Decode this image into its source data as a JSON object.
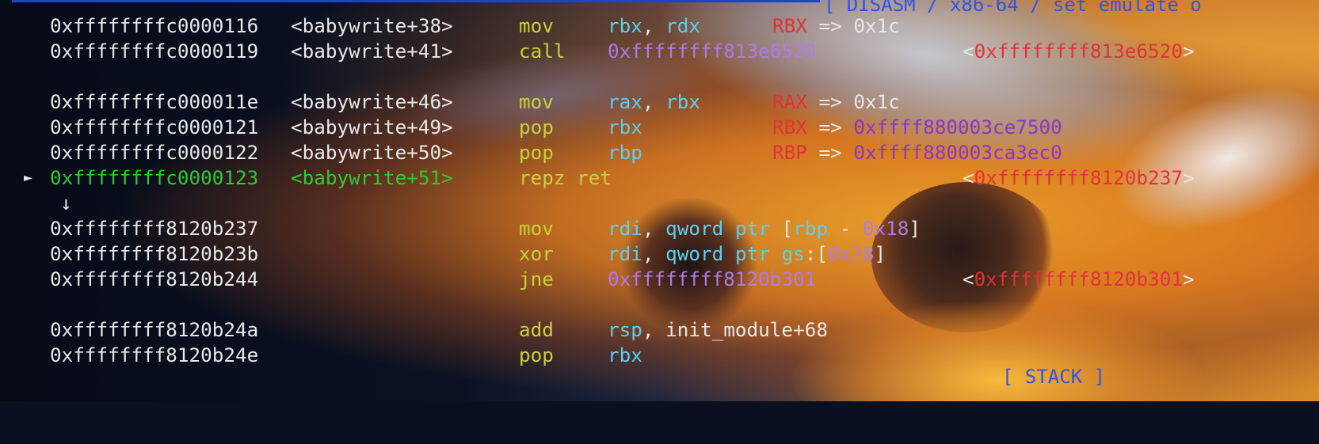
{
  "header_text": "[ DISASM / x86-64 / set emulate o",
  "footer_text": "[ STACK ]",
  "marker_symbol": "►",
  "down_arrow": "↓",
  "rows": [
    {
      "addr": "0xffffffffc0000116",
      "sym": "<babywrite+38>",
      "mnemonic": "mov",
      "op_a": "rbx",
      "sep": ", ",
      "op_b": "rdx",
      "reg": "RBX",
      "arrow": " => ",
      "val": "0x1c"
    },
    {
      "addr": "0xffffffffc0000119",
      "sym": "<babywrite+41>",
      "mnemonic": "call",
      "target": "0xffffffff813e6520",
      "lt": "<",
      "tgt": "0xffffffff813e6520",
      "gt": ">"
    },
    {
      "addr": "0xffffffffc000011e",
      "sym": "<babywrite+46>",
      "mnemonic": "mov",
      "op_a": "rax",
      "sep": ", ",
      "op_b": "rbx",
      "reg": "RAX",
      "arrow": " => ",
      "val": "0x1c"
    },
    {
      "addr": "0xffffffffc0000121",
      "sym": "<babywrite+49>",
      "mnemonic": "pop",
      "op_a": "rbx",
      "reg": "RBX",
      "arrow": " => ",
      "val": "0xffff880003ce7500"
    },
    {
      "addr": "0xffffffffc0000122",
      "sym": "<babywrite+50>",
      "mnemonic": "pop",
      "op_a": "rbp",
      "reg": "RBP",
      "arrow": " => ",
      "val": "0xffff880003ca3ec0"
    },
    {
      "addr": "0xffffffffc0000123",
      "sym": "<babywrite+51>",
      "mnemonic": "repz ret",
      "lt": "<",
      "tgt": "0xffffffff8120b237",
      "gt": ">"
    },
    {
      "addr": "0xffffffff8120b237",
      "mnemonic": "mov",
      "op_a": "rdi",
      "sep": ", ",
      "p1": "qword",
      "p2": "ptr",
      "lb": " [",
      "reg_in": "rbp",
      "minus": " - ",
      "imm": "0x18",
      "rb": "]"
    },
    {
      "addr": "0xffffffff8120b23b",
      "mnemonic": "xor",
      "op_a": "rdi",
      "sep": ", ",
      "p1": "qword",
      "p2": "ptr",
      "seg": "gs",
      "colon": ":[",
      "imm": "0x28",
      "rb": "]"
    },
    {
      "addr": "0xffffffff8120b244",
      "mnemonic": "jne",
      "target": "0xffffffff8120b301",
      "lt": "<",
      "tgt": "0xffffffff8120b301",
      "gt": ">"
    },
    {
      "addr": "0xffffffff8120b24a",
      "mnemonic": "add",
      "op_a": "rsp",
      "sep": ", ",
      "op_text": "init_module+68"
    },
    {
      "addr": "0xffffffff8120b24e",
      "mnemonic": "pop",
      "op_a": "rbx"
    }
  ]
}
